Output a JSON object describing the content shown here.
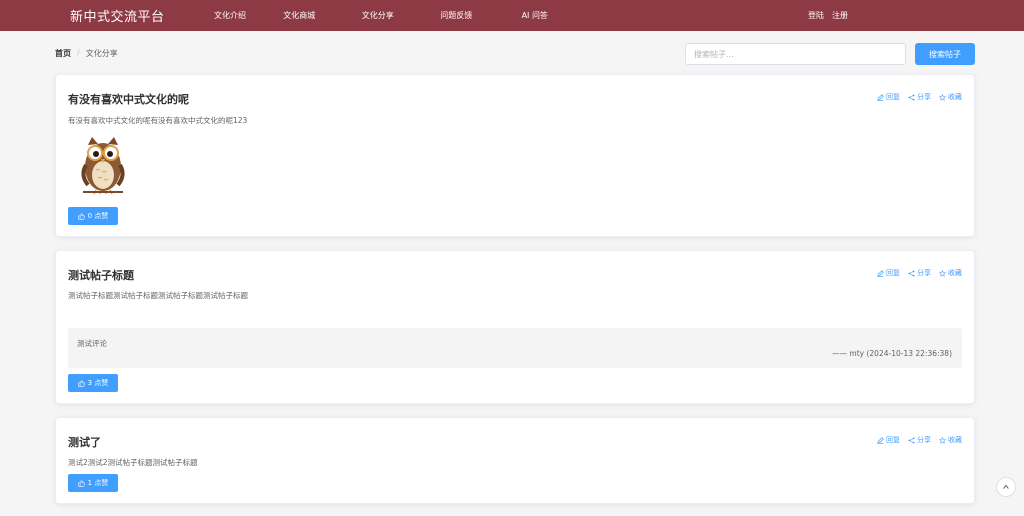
{
  "brand": "新中式交流平台",
  "nav": [
    "文化介绍",
    "文化商城",
    "文化分享",
    "问题反馈",
    "AI 问答"
  ],
  "auth": {
    "login": "登陆",
    "register": "注册"
  },
  "breadcrumb": {
    "home": "首页",
    "separator": "/",
    "current": "文化分享"
  },
  "search": {
    "placeholder": "搜索帖子...",
    "button": "搜索帖子"
  },
  "actions": {
    "reply": "回复",
    "share": "分享",
    "favorite": "收藏"
  },
  "posts": [
    {
      "title": "有没有喜欢中式文化的呢",
      "content": "有没有喜欢中式文化的呢有没有喜欢中式文化的呢123",
      "image": "owl-illustration",
      "likes": "0 点赞"
    },
    {
      "title": "测试帖子标题",
      "content": "测试帖子标题测试帖子标题测试帖子标题测试帖子标题",
      "comment": {
        "text": "测试评论",
        "meta": "—— mty (2024-10-13 22:36:38)"
      },
      "likes": "3 点赞"
    },
    {
      "title": "测试了",
      "content": "测试2测试2测试帖子标题测试帖子标题",
      "likes": "1 点赞"
    }
  ],
  "colors": {
    "header": "#8e3a44",
    "primary": "#409eff"
  }
}
